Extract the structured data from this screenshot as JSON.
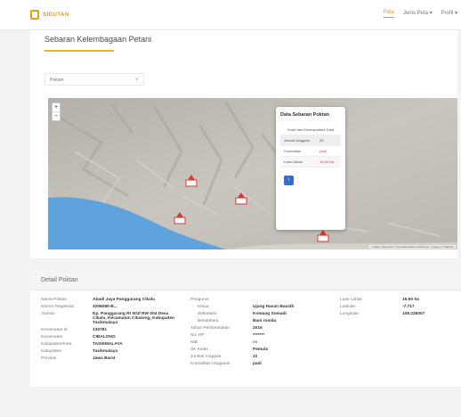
{
  "nav": {
    "logo": "SIDUTAN",
    "items": [
      {
        "label": "Peta",
        "active": true
      },
      {
        "label": "Jenis Peta ▾",
        "active": false
      },
      {
        "label": "Profil ▾",
        "active": false
      }
    ]
  },
  "page": {
    "title": "Sebaran Kelembagaan Petani",
    "select_value": "Poktan",
    "select_caret": "▾"
  },
  "map": {
    "zoom_in": "+",
    "zoom_out": "−",
    "attribution": "Leaflet | Map data © OpenStreetMap contributors, Imagery © Mapbox",
    "popup": {
      "title": "Data Sebaran Poktan",
      "header_row": "Kode dan Kelompoktani Data",
      "rows": [
        {
          "key": "Jumlah Anggota",
          "value": "22"
        },
        {
          "key": "Komoditas",
          "value": "padi"
        },
        {
          "key": "Luas Lahan",
          "value": "16.60 Ha"
        }
      ],
      "button": "i"
    }
  },
  "detail": {
    "header": "Detail Poktan",
    "col1": [
      {
        "key": "Nama Poktan",
        "value": "Abadi Jaya Panggarang Cikalu"
      },
      {
        "key": "Nomor Registrasi",
        "value": "3206080-B..."
      },
      {
        "key": "Alamat",
        "value": "Kp. Panggarang Rt 003/ RW 004 Desa Cikalu, Kecamatan Cibalong, Kabupaten Tasikmalaya"
      },
      {
        "key": "Kecamatan Id",
        "value": "130781"
      },
      {
        "key": "Kecamatan",
        "value": "CIBALONG"
      },
      {
        "key": "Kabupaten/Kota",
        "value": "TASIKMALAYA"
      },
      {
        "key": "Kabupaten",
        "value": "Tasikmalaya"
      },
      {
        "key": "Provinsi",
        "value": "Jawa Barat"
      }
    ],
    "col2_group_label": "Pengurus",
    "col2_sub": [
      {
        "key": "Ketua",
        "value": "Ujang Hasan Basidh"
      },
      {
        "key": "Sekretaris",
        "value": "Komang Somadi"
      },
      {
        "key": "Bendahara",
        "value": "Bani rosida"
      }
    ],
    "col2": [
      {
        "key": "Tahun Pembentukan",
        "value": "2016"
      },
      {
        "key": "No. HP",
        "value": "*******"
      },
      {
        "key": "NIB",
        "value": "no"
      },
      {
        "key": "SK Kelas",
        "value": "Pemula"
      },
      {
        "key": "Jumlah Anggota",
        "value": "22"
      },
      {
        "key": "Komoditas Unggulan",
        "value": "padi"
      }
    ],
    "col3": [
      {
        "key": "Luas Lahan",
        "value": "16.60 ha"
      },
      {
        "key": "Latitude",
        "value": "-7.717"
      },
      {
        "key": "Longitude",
        "value": "108.226007"
      }
    ]
  },
  "colors": {
    "accent": "#d4a017",
    "sea": "#5fa3dc",
    "marker": "#d9362f",
    "button": "#2c6fd6"
  }
}
